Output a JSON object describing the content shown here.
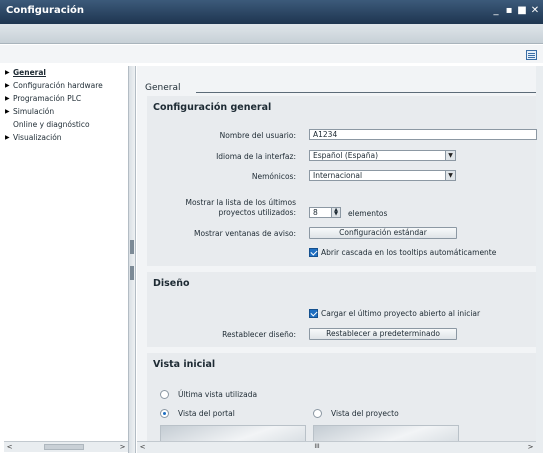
{
  "window": {
    "title": "Configuración",
    "minimize_glyph": "_",
    "restore_glyph": "▪",
    "maximize_glyph": "■",
    "close_glyph": "✕"
  },
  "tree": {
    "items": [
      {
        "label": "General",
        "expandable": true,
        "selected": true
      },
      {
        "label": "Configuración hardware",
        "expandable": true,
        "selected": false
      },
      {
        "label": "Programación PLC",
        "expandable": true,
        "selected": false
      },
      {
        "label": "Simulación",
        "expandable": true,
        "selected": false
      },
      {
        "label": "Online y diagnóstico",
        "expandable": false,
        "selected": false
      },
      {
        "label": "Visualización",
        "expandable": true,
        "selected": false
      }
    ]
  },
  "general": {
    "heading": "General",
    "config_section": {
      "title": "Configuración general",
      "username_label": "Nombre del usuario:",
      "username_value": "A1234",
      "language_label": "Idioma de la interfaz:",
      "language_value": "Español (España)",
      "mnemonics_label": "Nemónicos:",
      "mnemonics_value": "Internacional",
      "recent_label_line1": "Mostrar la lista de los últimos",
      "recent_label_line2": "proyectos utilizados:",
      "recent_value": "8",
      "recent_unit": "elementos",
      "alerts_label": "Mostrar ventanas de aviso:",
      "alerts_button": "Configuración estándar",
      "tooltips_checkbox": "Abrir cascada en los tooltips automáticamente"
    },
    "design_section": {
      "title": "Diseño",
      "load_last_checkbox": "Cargar el último proyecto abierto al iniciar",
      "reset_label": "Restablecer diseño:",
      "reset_button": "Restablecer a predeterminado"
    },
    "start_view_section": {
      "title": "Vista inicial",
      "options": [
        {
          "label": "Última vista utilizada",
          "selected": false
        },
        {
          "label": "Vista del portal",
          "selected": true
        },
        {
          "label": "Vista del proyecto",
          "selected": false
        }
      ]
    }
  },
  "icons": {
    "expand": "▶",
    "dropdown": "▼",
    "scroll_left": "<",
    "scroll_right": ">",
    "scroll_thumb": "III"
  },
  "colors": {
    "titlebar": "#2a4563",
    "accent": "#1f6fc2",
    "section_bg": "#e8ebee"
  }
}
